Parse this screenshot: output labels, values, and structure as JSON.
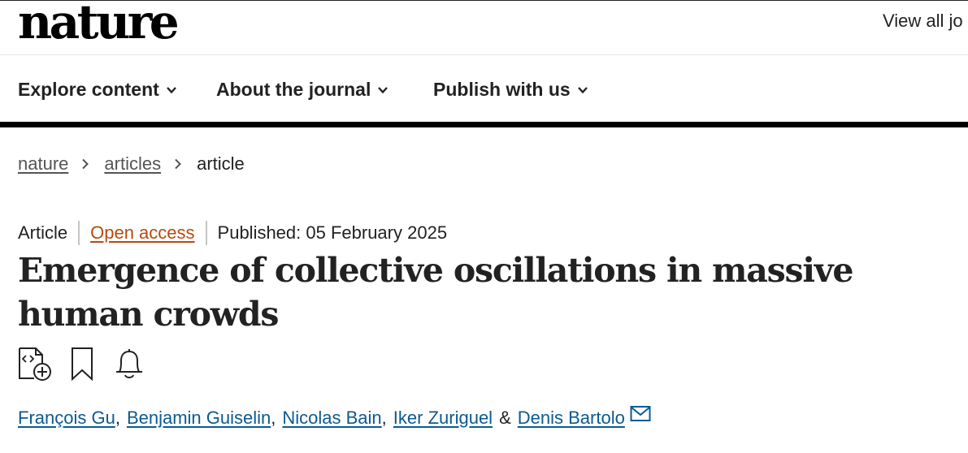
{
  "header": {
    "logo": "nature",
    "view_all": "View all jo"
  },
  "nav": {
    "items": [
      {
        "label": "Explore content"
      },
      {
        "label": "About the journal"
      },
      {
        "label": "Publish with us"
      }
    ]
  },
  "breadcrumb": {
    "items": [
      "nature",
      "articles",
      "article"
    ]
  },
  "article": {
    "type": "Article",
    "access": "Open access",
    "published": "Published: 05 February 2025",
    "title": "Emergence of collective oscillations in massive human crowds"
  },
  "icons": [
    "cite-icon",
    "bookmark-icon",
    "alert-bell-icon"
  ],
  "authors": {
    "list": [
      "François Gu",
      "Benjamin Guiselin",
      "Nicolas Bain",
      "Iker Zuriguel",
      "Denis Bartolo"
    ],
    "separator": ",",
    "ampersand": "&"
  },
  "colors": {
    "open_access": "#b84a0f",
    "author_link": "#0b5a92",
    "text": "#222222"
  }
}
